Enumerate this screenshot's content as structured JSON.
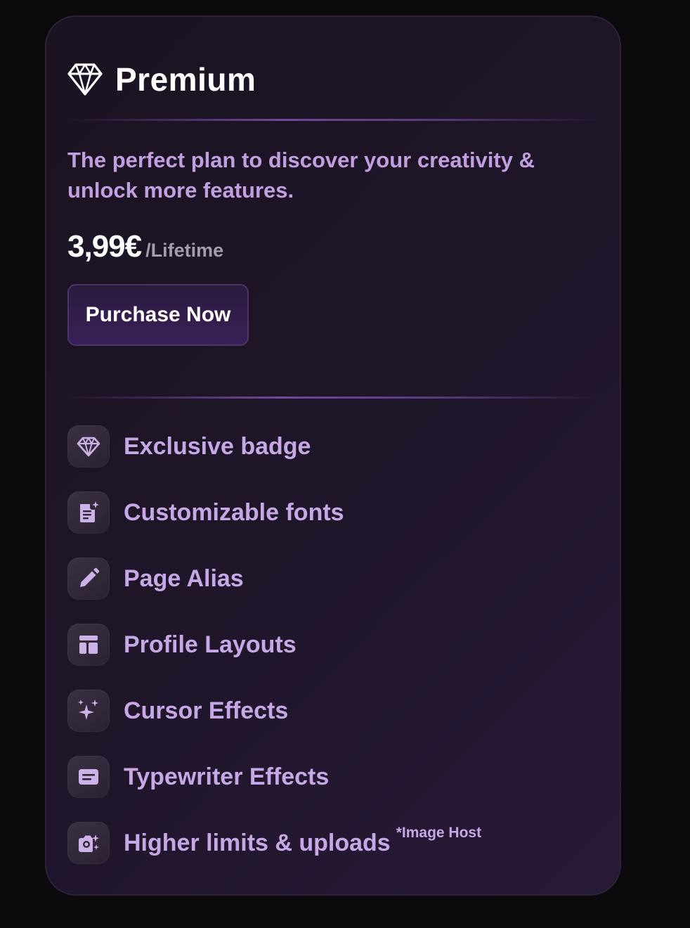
{
  "plan": {
    "icon": "diamond-icon",
    "title": "Premium",
    "description": "The perfect plan to discover your creativity & unlock more features.",
    "price": "3,99€",
    "period": "/Lifetime",
    "purchase_label": "Purchase Now"
  },
  "features": [
    {
      "icon": "diamond-icon",
      "label": "Exclusive badge",
      "note": ""
    },
    {
      "icon": "document-sparkle-icon",
      "label": "Customizable fonts",
      "note": ""
    },
    {
      "icon": "pencil-icon",
      "label": "Page Alias",
      "note": ""
    },
    {
      "icon": "layout-icon",
      "label": "Profile Layouts",
      "note": ""
    },
    {
      "icon": "sparkles-icon",
      "label": "Cursor Effects",
      "note": ""
    },
    {
      "icon": "message-icon",
      "label": "Typewriter Effects",
      "note": ""
    },
    {
      "icon": "camera-sparkle-icon",
      "label": "Higher limits & uploads",
      "note": "*Image Host"
    }
  ],
  "colors": {
    "page_background": "#0b0a0c",
    "card_background": "#1e1528",
    "accent_text": "#c7a8e6",
    "feature_icon": "#cdb2e8",
    "button_background": "#3a2058"
  }
}
